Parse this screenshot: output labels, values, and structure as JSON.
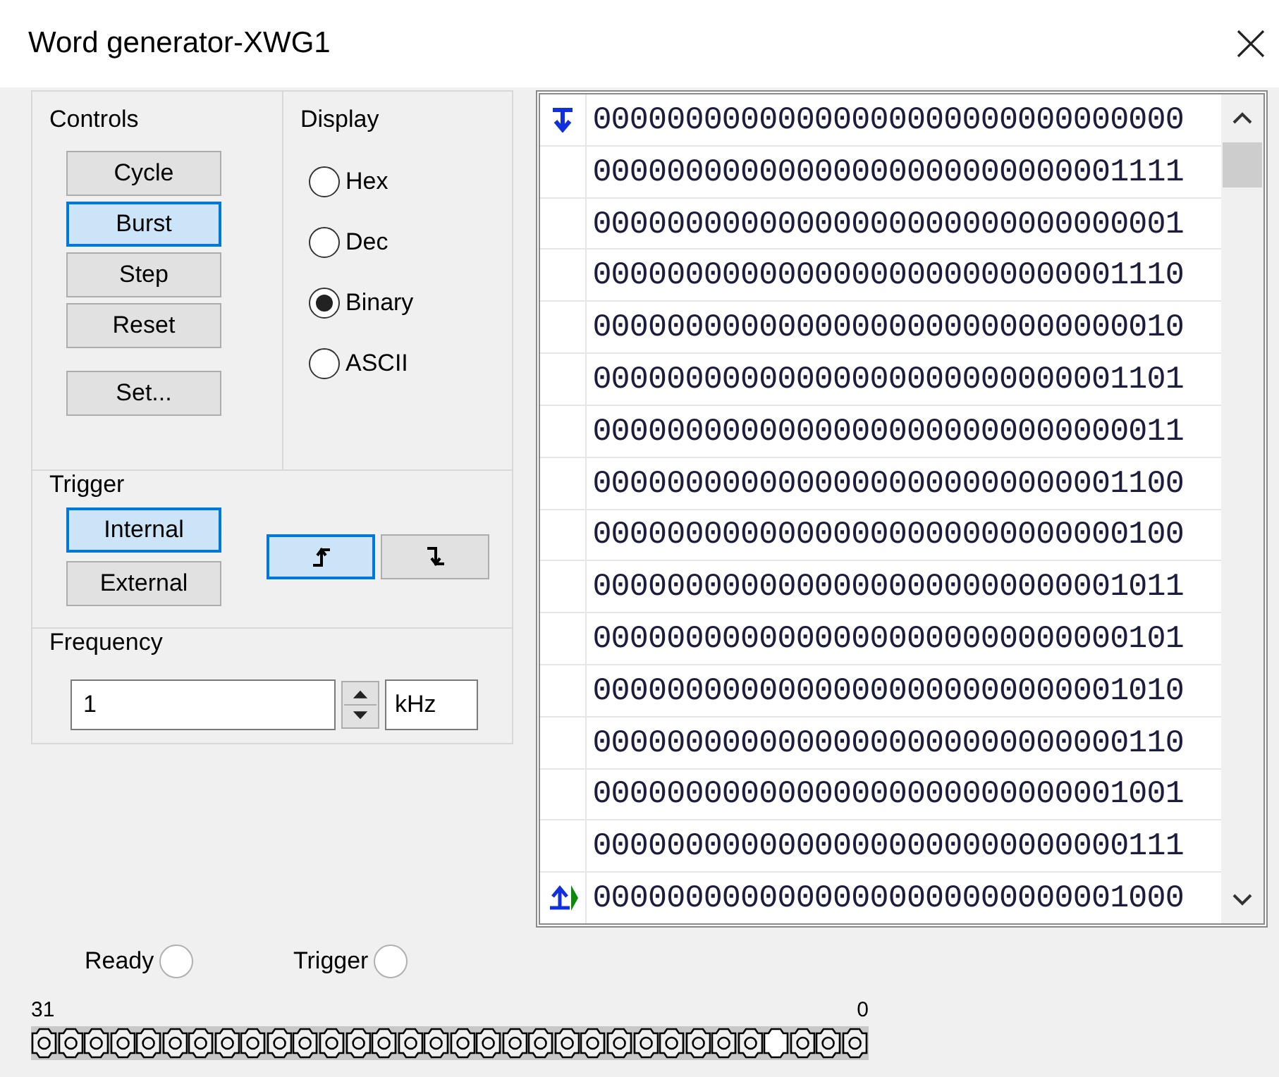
{
  "window": {
    "title": "Word generator-XWG1"
  },
  "controls": {
    "title": "Controls",
    "buttons": [
      {
        "label": "Cycle",
        "selected": false
      },
      {
        "label": "Burst",
        "selected": true
      },
      {
        "label": "Step",
        "selected": false
      },
      {
        "label": "Reset",
        "selected": false
      }
    ],
    "set_button": "Set..."
  },
  "display": {
    "title": "Display",
    "options": [
      {
        "label": "Hex",
        "selected": false
      },
      {
        "label": "Dec",
        "selected": false
      },
      {
        "label": "Binary",
        "selected": true
      },
      {
        "label": "ASCII",
        "selected": false
      }
    ]
  },
  "trigger": {
    "title": "Trigger",
    "sources": [
      {
        "label": "Internal",
        "selected": true
      },
      {
        "label": "External",
        "selected": false
      }
    ],
    "edges": [
      {
        "kind": "rising",
        "selected": true
      },
      {
        "kind": "falling",
        "selected": false
      }
    ]
  },
  "frequency": {
    "title": "Frequency",
    "value": "1",
    "unit": "kHz"
  },
  "words": [
    {
      "value": "00000000000000000000000000000000",
      "initial": true,
      "final": false,
      "current": false
    },
    {
      "value": "00000000000000000000000000001111",
      "initial": false,
      "final": false,
      "current": false
    },
    {
      "value": "00000000000000000000000000000001",
      "initial": false,
      "final": false,
      "current": false
    },
    {
      "value": "00000000000000000000000000001110",
      "initial": false,
      "final": false,
      "current": false
    },
    {
      "value": "00000000000000000000000000000010",
      "initial": false,
      "final": false,
      "current": false
    },
    {
      "value": "00000000000000000000000000001101",
      "initial": false,
      "final": false,
      "current": false
    },
    {
      "value": "00000000000000000000000000000011",
      "initial": false,
      "final": false,
      "current": false
    },
    {
      "value": "00000000000000000000000000001100",
      "initial": false,
      "final": false,
      "current": false
    },
    {
      "value": "00000000000000000000000000000100",
      "initial": false,
      "final": false,
      "current": false
    },
    {
      "value": "00000000000000000000000000001011",
      "initial": false,
      "final": false,
      "current": false
    },
    {
      "value": "00000000000000000000000000000101",
      "initial": false,
      "final": false,
      "current": false
    },
    {
      "value": "00000000000000000000000000001010",
      "initial": false,
      "final": false,
      "current": false
    },
    {
      "value": "00000000000000000000000000000110",
      "initial": false,
      "final": false,
      "current": false
    },
    {
      "value": "00000000000000000000000000001001",
      "initial": false,
      "final": false,
      "current": false
    },
    {
      "value": "00000000000000000000000000000111",
      "initial": false,
      "final": false,
      "current": false
    },
    {
      "value": "00000000000000000000000000001000",
      "initial": false,
      "final": true,
      "current": true
    }
  ],
  "indicators": [
    {
      "label": "Ready",
      "on": false
    },
    {
      "label": "Trigger",
      "on": false
    }
  ],
  "pins": {
    "high_label": "31",
    "low_label": "0",
    "states": [
      {
        "on": false
      },
      {
        "on": false
      },
      {
        "on": false
      },
      {
        "on": false
      },
      {
        "on": false
      },
      {
        "on": false
      },
      {
        "on": false
      },
      {
        "on": false
      },
      {
        "on": false
      },
      {
        "on": false
      },
      {
        "on": false
      },
      {
        "on": false
      },
      {
        "on": false
      },
      {
        "on": false
      },
      {
        "on": false
      },
      {
        "on": false
      },
      {
        "on": false
      },
      {
        "on": false
      },
      {
        "on": false
      },
      {
        "on": false
      },
      {
        "on": false
      },
      {
        "on": false
      },
      {
        "on": false
      },
      {
        "on": false
      },
      {
        "on": false
      },
      {
        "on": false
      },
      {
        "on": false
      },
      {
        "on": false
      },
      {
        "on": true
      },
      {
        "on": false
      },
      {
        "on": false
      },
      {
        "on": false
      }
    ]
  }
}
